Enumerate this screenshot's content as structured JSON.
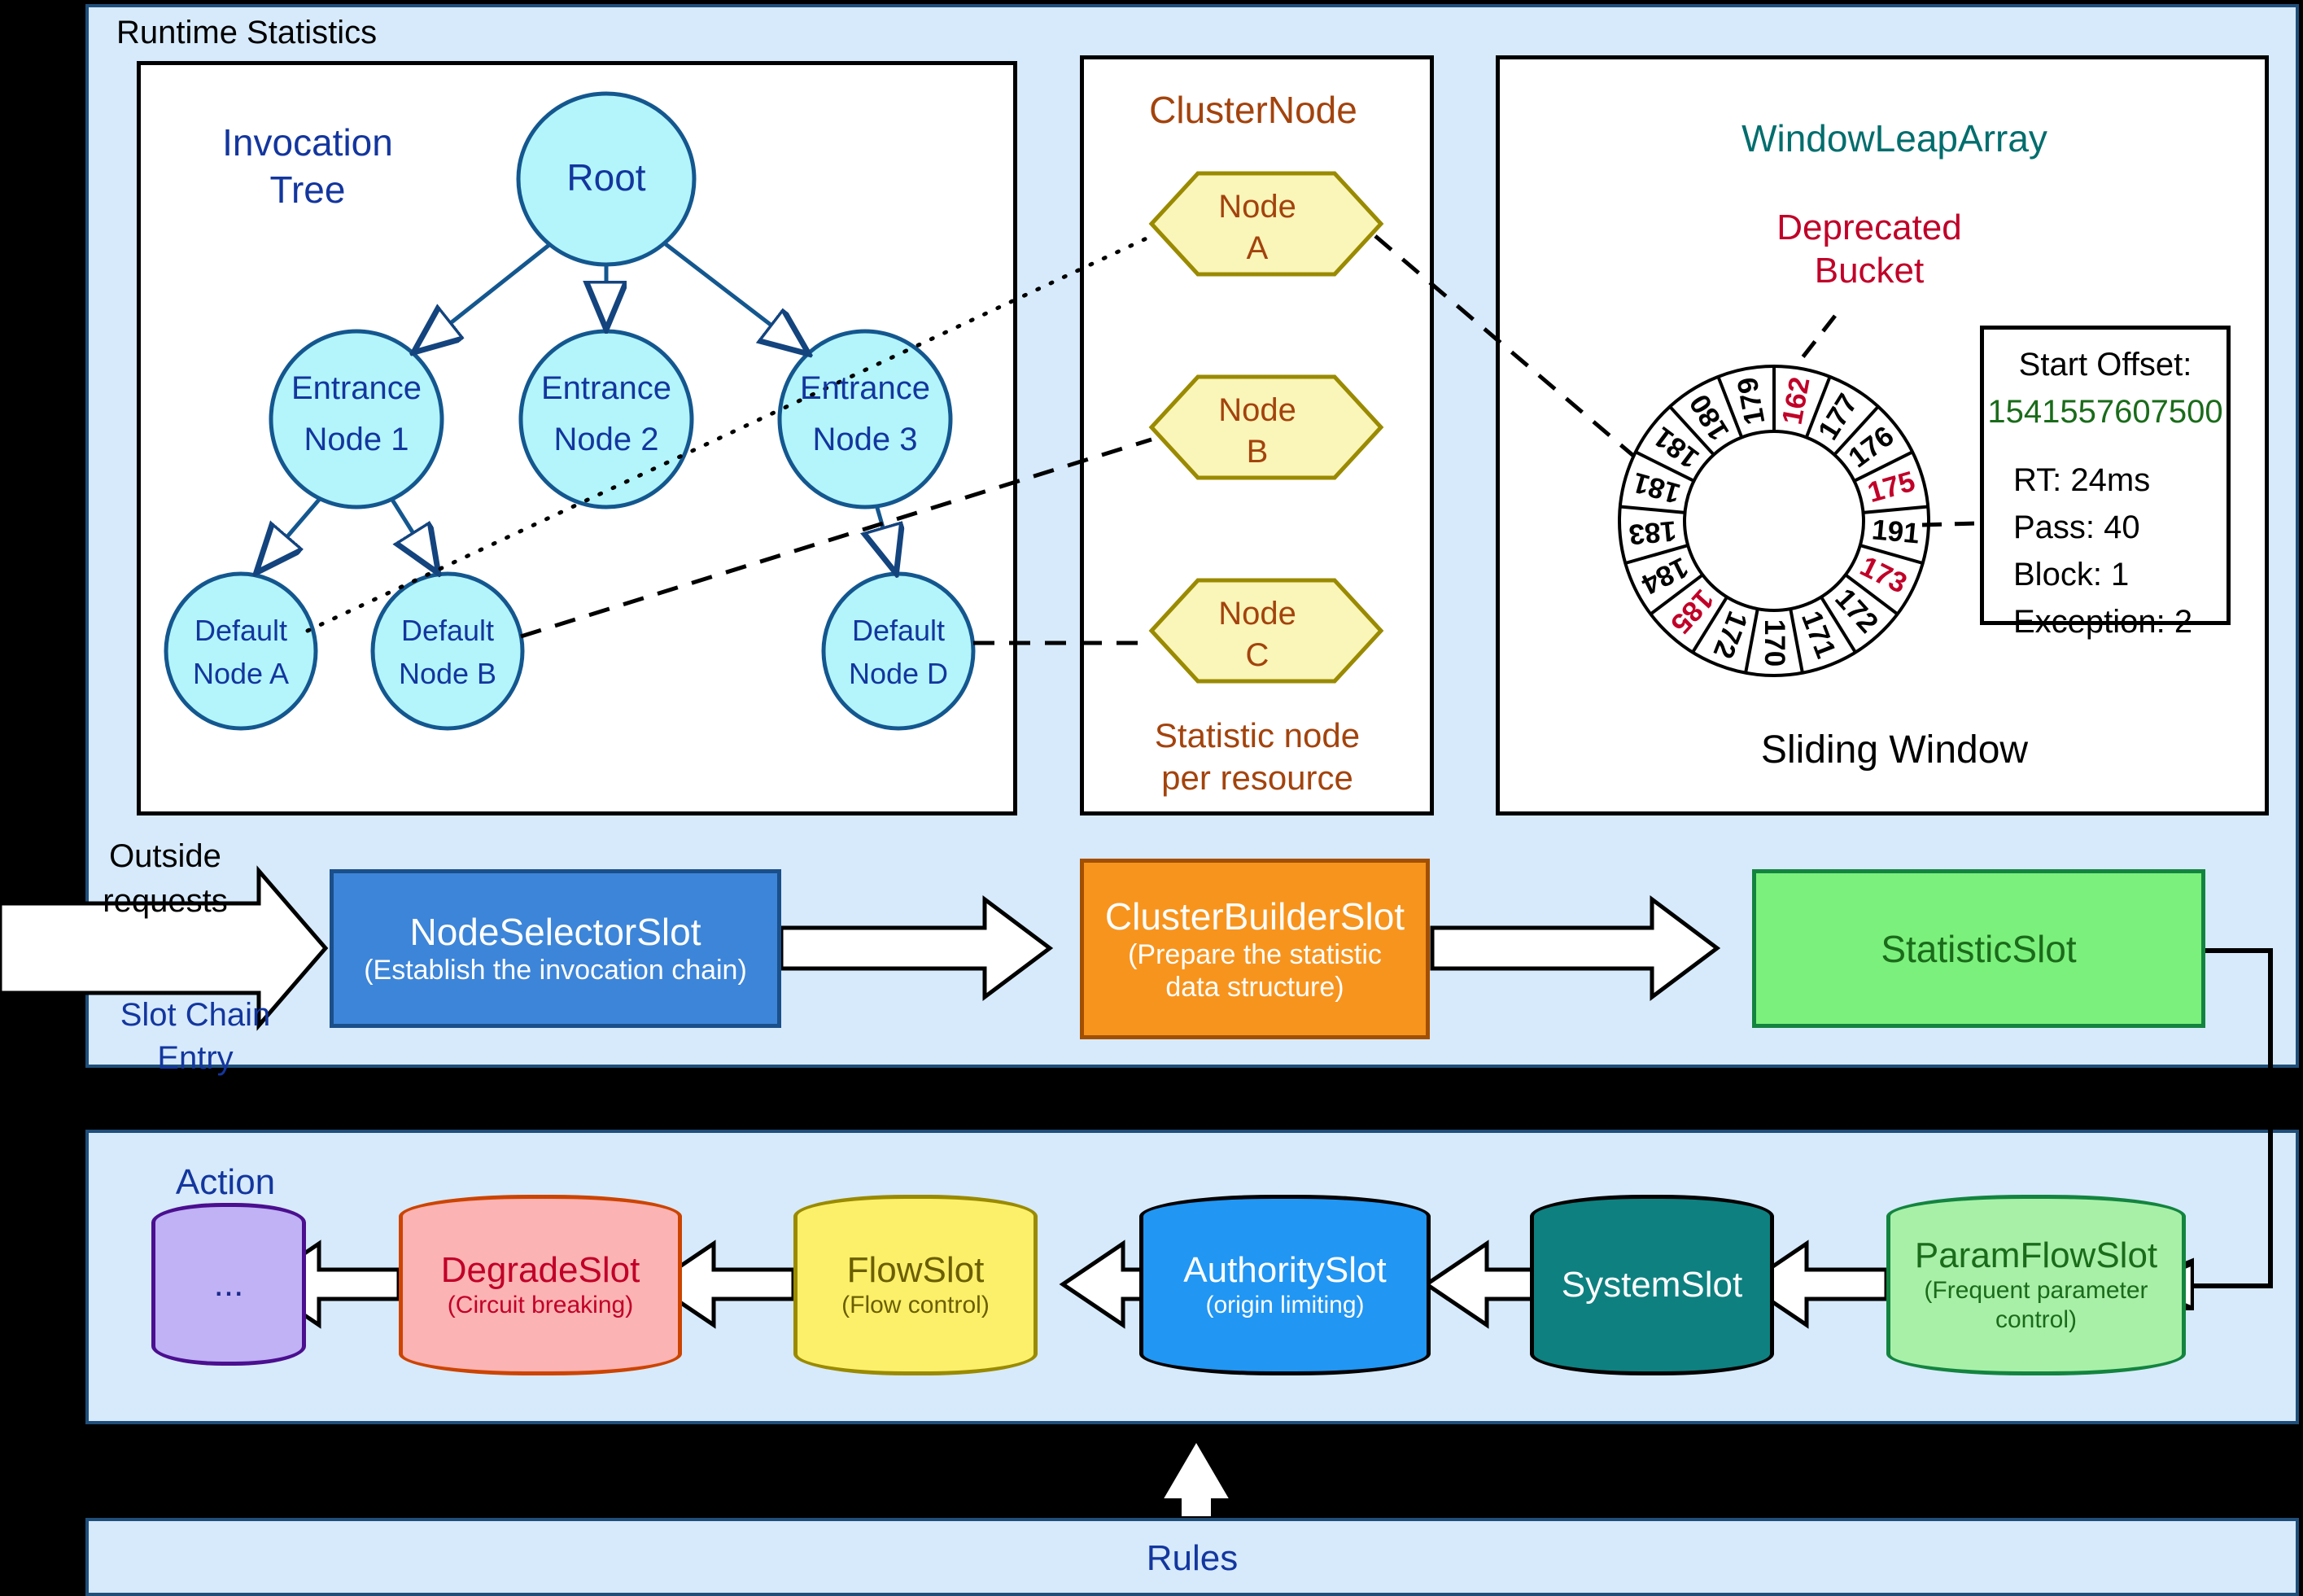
{
  "panels": {
    "runtime": {
      "title": "Runtime Statistics"
    },
    "action": {
      "title": "Action"
    },
    "rules": {
      "title": "Rules"
    }
  },
  "invocation_tree": {
    "title_line1": "Invocation",
    "title_line2": "Tree",
    "root": "Root",
    "entrance_nodes": [
      {
        "line1": "Entrance",
        "line2": "Node 1"
      },
      {
        "line1": "Entrance",
        "line2": "Node 2"
      },
      {
        "line1": "Entrance",
        "line2": "Node 3"
      }
    ],
    "default_nodes": [
      {
        "line1": "Default",
        "line2": "Node A"
      },
      {
        "line1": "Default",
        "line2": "Node B"
      },
      {
        "line1": "Default",
        "line2": "Node D"
      }
    ]
  },
  "cluster_node": {
    "title": "ClusterNode",
    "caption_line1": "Statistic node",
    "caption_line2": "per resource",
    "nodes": [
      {
        "line1": "Node",
        "line2": "A"
      },
      {
        "line1": "Node",
        "line2": "B"
      },
      {
        "line1": "Node",
        "line2": "C"
      }
    ]
  },
  "window_leap_array": {
    "title": "WindowLeapArray",
    "deprecated_line1": "Deprecated",
    "deprecated_line2": "Bucket",
    "caption": "Sliding Window",
    "info": {
      "start_offset_label": "Start Offset:",
      "start_offset_value": "1541557607500",
      "rt": "RT: 24ms",
      "pass": "Pass: 40",
      "block": "Block: 1",
      "exception": "Exception: 2"
    },
    "colors": {
      "title": "#006d6d",
      "deprecated": "#c00028",
      "offset": "#1a6b1a"
    }
  },
  "chart_data": {
    "type": "pie",
    "title": "Sliding Window buckets",
    "categories": [
      "162",
      "177",
      "176",
      "175",
      "191",
      "173",
      "172",
      "171",
      "170",
      "172",
      "185",
      "184",
      "183",
      "181",
      "181",
      "180",
      "179"
    ],
    "values": [
      1,
      1,
      1,
      1,
      1,
      1,
      1,
      1,
      1,
      1,
      1,
      1,
      1,
      1,
      1,
      1,
      1
    ],
    "segments": [
      {
        "label": "162",
        "deprecated": true
      },
      {
        "label": "177",
        "deprecated": false
      },
      {
        "label": "176",
        "deprecated": false
      },
      {
        "label": "175",
        "deprecated": true
      },
      {
        "label": "191",
        "deprecated": false
      },
      {
        "label": "173",
        "deprecated": true
      },
      {
        "label": "172",
        "deprecated": false
      },
      {
        "label": "171",
        "deprecated": false
      },
      {
        "label": "170",
        "deprecated": false
      },
      {
        "label": "172",
        "deprecated": false
      },
      {
        "label": "185",
        "deprecated": true
      },
      {
        "label": "184",
        "deprecated": false
      },
      {
        "label": "183",
        "deprecated": false
      },
      {
        "label": "181",
        "deprecated": false
      },
      {
        "label": "181",
        "deprecated": false
      },
      {
        "label": "180",
        "deprecated": false
      },
      {
        "label": "179",
        "deprecated": false
      }
    ],
    "legend": [
      "Deprecated Bucket"
    ],
    "xlabel": "",
    "ylabel": ""
  },
  "entry": {
    "outside_line1": "Outside",
    "outside_line2": "requests",
    "chain_line1": "Slot Chain",
    "chain_line2": "Entry"
  },
  "slot_chain": [
    {
      "name": "NodeSelectorSlot",
      "sub": "(Establish the invocation chain)",
      "fill": "#3d85d8",
      "stroke": "#1a4f8a",
      "text": "#ffffff"
    },
    {
      "name": "ClusterBuilderSlot",
      "sub": "(Prepare the statistic\ndata structure)",
      "fill": "#f7941e",
      "stroke": "#a34f00",
      "text": "#ffffff"
    },
    {
      "name": "StatisticSlot",
      "sub": "",
      "fill": "#7cf07c",
      "stroke": "#13843f",
      "text": "#1a6b1a"
    }
  ],
  "action_slots": [
    {
      "name": "...",
      "sub": "",
      "fill": "#c0b2f5",
      "stroke": "#4b0f8f",
      "text": "#1b2a8c"
    },
    {
      "name": "DegradeSlot",
      "sub": "(Circuit breaking)",
      "fill": "#fcb3b3",
      "stroke": "#cc4400",
      "text": "#c00028"
    },
    {
      "name": "FlowSlot",
      "sub": "(Flow control)",
      "fill": "#fcf06a",
      "stroke": "#9a8a00",
      "text": "#6b5e00"
    },
    {
      "name": "AuthoritySlot",
      "sub": "(origin limiting)",
      "fill": "#2196f3",
      "stroke": "#000000",
      "text": "#ffffff"
    },
    {
      "name": "SystemSlot",
      "sub": "",
      "fill": "#0e8080",
      "stroke": "#000000",
      "text": "#ffffff"
    },
    {
      "name": "ParamFlowSlot",
      "sub": "(Frequent parameter\ncontrol)",
      "fill": "#a8f0a8",
      "stroke": "#13843f",
      "text": "#1a6b1a"
    }
  ]
}
